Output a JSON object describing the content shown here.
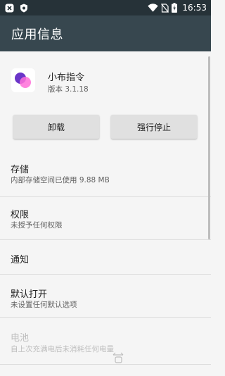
{
  "status_bar": {
    "time": "16:53",
    "icons": [
      "app-notification-icon",
      "shield-icon",
      "wifi-icon",
      "no-sim-icon",
      "battery-charging-icon"
    ]
  },
  "toolbar": {
    "title": "应用信息"
  },
  "app": {
    "name": "小布指令",
    "version": "版本 3.1.18"
  },
  "buttons": {
    "uninstall": "卸载",
    "force_stop": "强行停止"
  },
  "items": [
    {
      "title": "存储",
      "subtitle": "内部存储空间已使用 9.88 MB"
    },
    {
      "title": "权限",
      "subtitle": "未授予任何权限"
    },
    {
      "title": "通知"
    },
    {
      "title": "默认打开",
      "subtitle": "未设置任何默认选项"
    },
    {
      "title": "电池",
      "subtitle": "自上次充满电后未消耗任何电量",
      "disabled": true
    }
  ],
  "colors": {
    "status_bar": "#263238",
    "toolbar": "#37474f",
    "background": "#f5f5f5",
    "button": "#e0e0e0",
    "app_icon_purple": "#6a35c8",
    "app_icon_pink": "#ff6fd8"
  }
}
